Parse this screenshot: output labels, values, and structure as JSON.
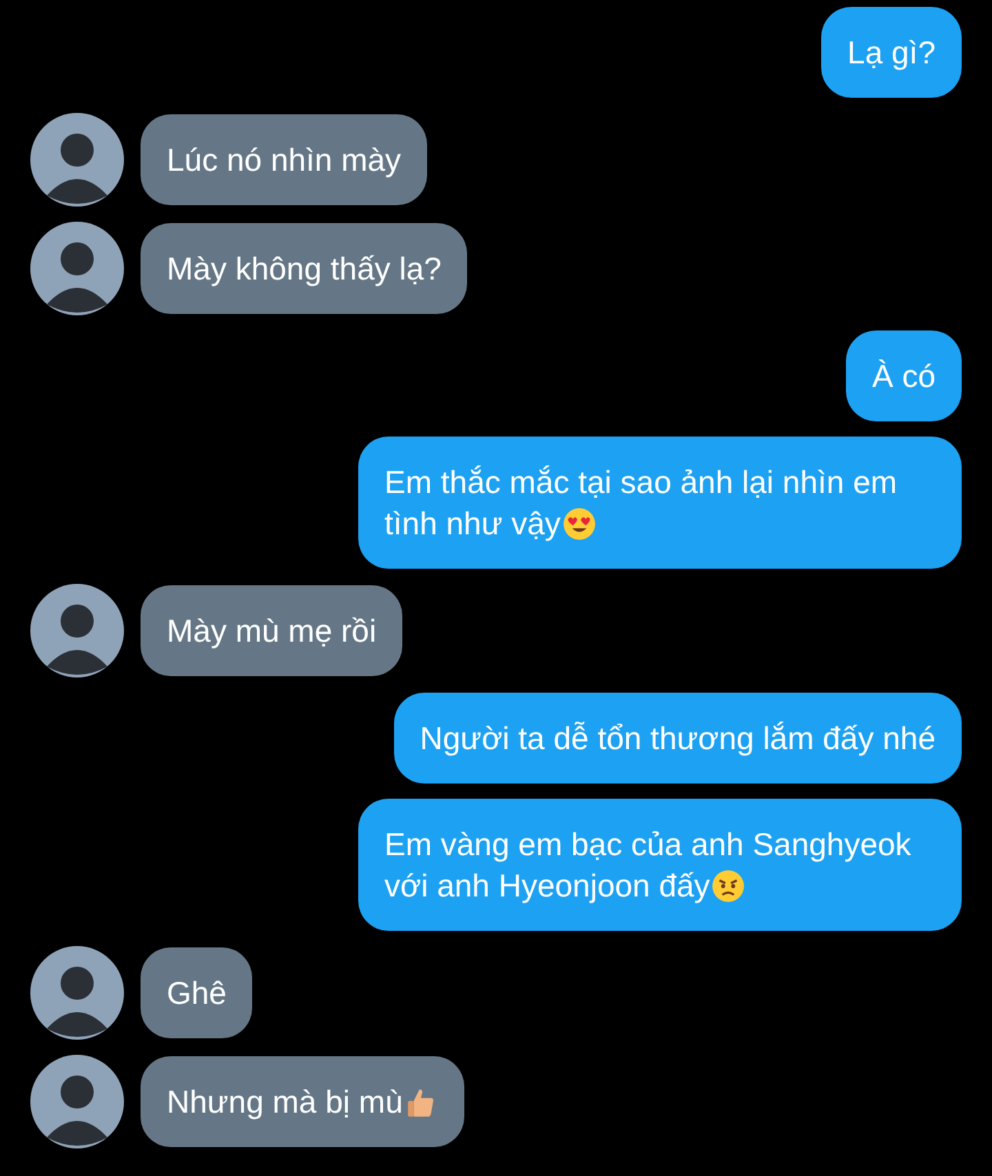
{
  "messages": [
    {
      "kind": "sent",
      "text": "Lạ gì?"
    },
    {
      "kind": "received",
      "text": "Lúc nó nhìn mày"
    },
    {
      "kind": "received",
      "text": "Mày không thấy lạ?"
    },
    {
      "kind": "sent",
      "text": "À có"
    },
    {
      "kind": "sent",
      "text": "Em thắc mắc tại sao ảnh lại nhìn em tình như vậy",
      "emoji": {
        "kind": "heart-eyes"
      }
    },
    {
      "kind": "received",
      "text": "Mày mù mẹ rồi"
    },
    {
      "kind": "sent",
      "text": "Người ta dễ tổn thương lắm đấy nhé"
    },
    {
      "kind": "sent",
      "text": "Em vàng em bạc của anh Sanghyeok với anh Hyeonjoon đấy",
      "emoji": {
        "kind": "angry"
      }
    },
    {
      "kind": "received",
      "text": "Ghê"
    },
    {
      "kind": "received",
      "text": "Nhưng mà bị mù",
      "emoji": {
        "kind": "thumbs-up"
      }
    }
  ]
}
